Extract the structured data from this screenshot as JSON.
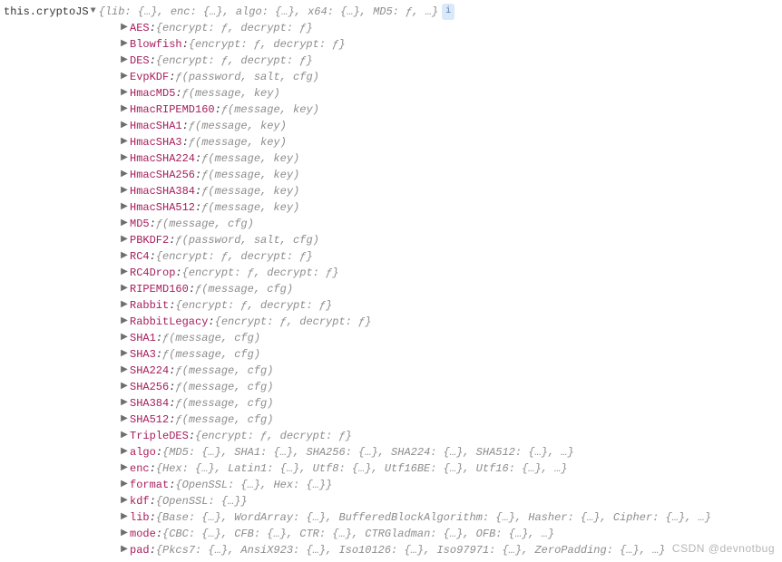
{
  "root": {
    "label": "this.cryptoJS",
    "summary_props": [
      {
        "name": "lib",
        "val": "{…}"
      },
      {
        "name": "enc",
        "val": "{…}"
      },
      {
        "name": "algo",
        "val": "{…}"
      },
      {
        "name": "x64",
        "val": "{…}"
      },
      {
        "name": "MD5",
        "val": "ƒ"
      }
    ],
    "summary_ellipsis": "…",
    "info_badge": "i"
  },
  "props": [
    {
      "name": "AES",
      "type": "obj",
      "inner": [
        {
          "n": "encrypt",
          "v": "ƒ"
        },
        {
          "n": "decrypt",
          "v": "ƒ"
        }
      ]
    },
    {
      "name": "Blowfish",
      "type": "obj",
      "inner": [
        {
          "n": "encrypt",
          "v": "ƒ"
        },
        {
          "n": "decrypt",
          "v": "ƒ"
        }
      ]
    },
    {
      "name": "DES",
      "type": "obj",
      "inner": [
        {
          "n": "encrypt",
          "v": "ƒ"
        },
        {
          "n": "decrypt",
          "v": "ƒ"
        }
      ]
    },
    {
      "name": "EvpKDF",
      "type": "fn",
      "sig": "(password, salt, cfg)"
    },
    {
      "name": "HmacMD5",
      "type": "fn",
      "sig": "(message, key)"
    },
    {
      "name": "HmacRIPEMD160",
      "type": "fn",
      "sig": "(message, key)"
    },
    {
      "name": "HmacSHA1",
      "type": "fn",
      "sig": "(message, key)"
    },
    {
      "name": "HmacSHA3",
      "type": "fn",
      "sig": "(message, key)"
    },
    {
      "name": "HmacSHA224",
      "type": "fn",
      "sig": "(message, key)"
    },
    {
      "name": "HmacSHA256",
      "type": "fn",
      "sig": "(message, key)"
    },
    {
      "name": "HmacSHA384",
      "type": "fn",
      "sig": "(message, key)"
    },
    {
      "name": "HmacSHA512",
      "type": "fn",
      "sig": "(message, key)"
    },
    {
      "name": "MD5",
      "type": "fn",
      "sig": "(message, cfg)"
    },
    {
      "name": "PBKDF2",
      "type": "fn",
      "sig": "(password, salt, cfg)"
    },
    {
      "name": "RC4",
      "type": "obj",
      "inner": [
        {
          "n": "encrypt",
          "v": "ƒ"
        },
        {
          "n": "decrypt",
          "v": "ƒ"
        }
      ]
    },
    {
      "name": "RC4Drop",
      "type": "obj",
      "inner": [
        {
          "n": "encrypt",
          "v": "ƒ"
        },
        {
          "n": "decrypt",
          "v": "ƒ"
        }
      ]
    },
    {
      "name": "RIPEMD160",
      "type": "fn",
      "sig": "(message, cfg)"
    },
    {
      "name": "Rabbit",
      "type": "obj",
      "inner": [
        {
          "n": "encrypt",
          "v": "ƒ"
        },
        {
          "n": "decrypt",
          "v": "ƒ"
        }
      ]
    },
    {
      "name": "RabbitLegacy",
      "type": "obj",
      "inner": [
        {
          "n": "encrypt",
          "v": "ƒ"
        },
        {
          "n": "decrypt",
          "v": "ƒ"
        }
      ]
    },
    {
      "name": "SHA1",
      "type": "fn",
      "sig": "(message, cfg)"
    },
    {
      "name": "SHA3",
      "type": "fn",
      "sig": "(message, cfg)"
    },
    {
      "name": "SHA224",
      "type": "fn",
      "sig": "(message, cfg)"
    },
    {
      "name": "SHA256",
      "type": "fn",
      "sig": "(message, cfg)"
    },
    {
      "name": "SHA384",
      "type": "fn",
      "sig": "(message, cfg)"
    },
    {
      "name": "SHA512",
      "type": "fn",
      "sig": "(message, cfg)"
    },
    {
      "name": "TripleDES",
      "type": "obj",
      "inner": [
        {
          "n": "encrypt",
          "v": "ƒ"
        },
        {
          "n": "decrypt",
          "v": "ƒ"
        }
      ]
    },
    {
      "name": "algo",
      "type": "obj",
      "inner": [
        {
          "n": "MD5",
          "v": "{…}"
        },
        {
          "n": "SHA1",
          "v": "{…}"
        },
        {
          "n": "SHA256",
          "v": "{…}"
        },
        {
          "n": "SHA224",
          "v": "{…}"
        },
        {
          "n": "SHA512",
          "v": "{…}"
        }
      ],
      "ellipsis": true
    },
    {
      "name": "enc",
      "type": "obj",
      "inner": [
        {
          "n": "Hex",
          "v": "{…}"
        },
        {
          "n": "Latin1",
          "v": "{…}"
        },
        {
          "n": "Utf8",
          "v": "{…}"
        },
        {
          "n": "Utf16BE",
          "v": "{…}"
        },
        {
          "n": "Utf16",
          "v": "{…}"
        }
      ],
      "ellipsis": true
    },
    {
      "name": "format",
      "type": "obj",
      "inner": [
        {
          "n": "OpenSSL",
          "v": "{…}"
        },
        {
          "n": "Hex",
          "v": "{…}"
        }
      ]
    },
    {
      "name": "kdf",
      "type": "obj",
      "inner": [
        {
          "n": "OpenSSL",
          "v": "{…}"
        }
      ]
    },
    {
      "name": "lib",
      "type": "obj",
      "inner": [
        {
          "n": "Base",
          "v": "{…}"
        },
        {
          "n": "WordArray",
          "v": "{…}"
        },
        {
          "n": "BufferedBlockAlgorithm",
          "v": "{…}"
        },
        {
          "n": "Hasher",
          "v": "{…}"
        },
        {
          "n": "Cipher",
          "v": "{…}"
        }
      ],
      "ellipsis": true
    },
    {
      "name": "mode",
      "type": "obj",
      "inner": [
        {
          "n": "CBC",
          "v": "{…}"
        },
        {
          "n": "CFB",
          "v": "{…}"
        },
        {
          "n": "CTR",
          "v": "{…}"
        },
        {
          "n": "CTRGladman",
          "v": "{…}"
        },
        {
          "n": "OFB",
          "v": "{…}"
        }
      ],
      "ellipsis": true
    },
    {
      "name": "pad",
      "type": "obj",
      "inner": [
        {
          "n": "Pkcs7",
          "v": "{…}"
        },
        {
          "n": "AnsiX923",
          "v": "{…}"
        },
        {
          "n": "Iso10126",
          "v": "{…}"
        },
        {
          "n": "Iso97971",
          "v": "{…}"
        },
        {
          "n": "ZeroPadding",
          "v": "{…}"
        }
      ],
      "ellipsis": true
    }
  ],
  "watermark": "CSDN @devnotbug"
}
